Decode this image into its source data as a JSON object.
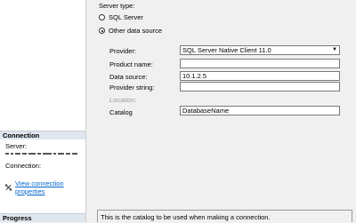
{
  "sidebar": {
    "connection_header": "Connection",
    "server_label": "Server:",
    "connection_label": "Connection:",
    "view_connection_properties": "View connection properties",
    "progress_header": "Progress"
  },
  "server_type": {
    "title": "Server type:",
    "option_sql_server": "SQL Server",
    "option_other": "Other data source",
    "selected": "Other data source"
  },
  "form": {
    "provider_label": "Provider:",
    "provider_value": "SQL Server Native Client 11.0",
    "product_name_label": "Product name:",
    "product_name_value": "",
    "data_source_label": "Data source:",
    "data_source_value": "10.1.2.5",
    "provider_string_label": "Provider string:",
    "provider_string_value": "",
    "location_label": "Location:",
    "catalog_label": "Catalog",
    "catalog_value": "DatabaseName"
  },
  "description": "This is the catalog to be used when making a connection."
}
